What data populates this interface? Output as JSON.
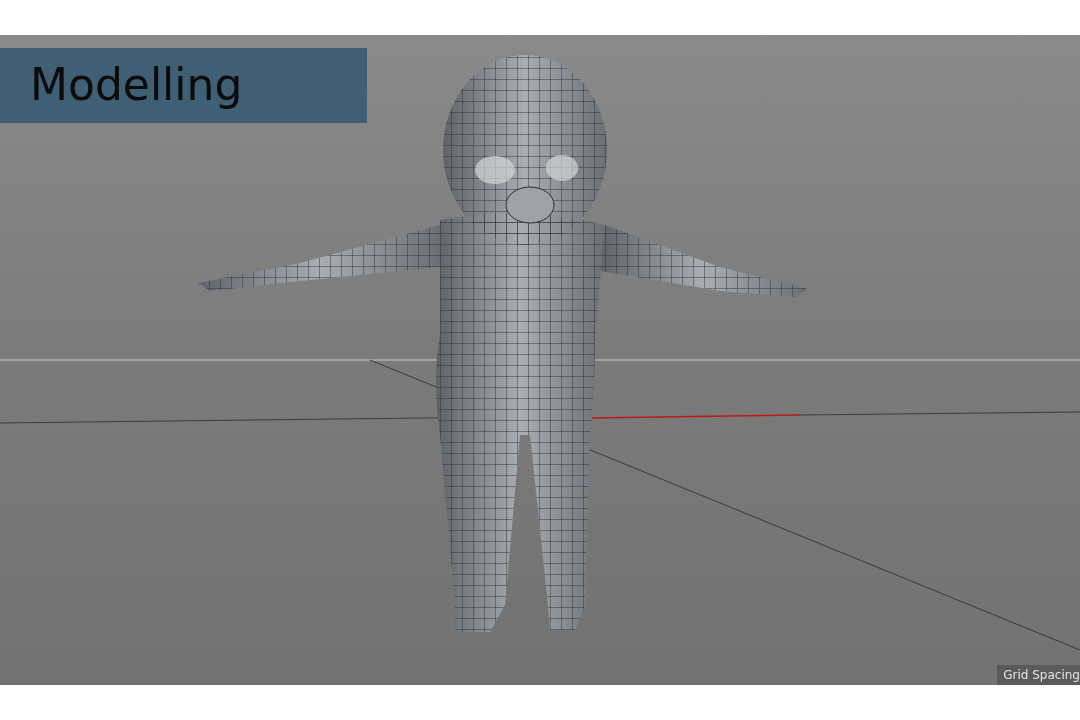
{
  "slide": {
    "title": "Modelling"
  },
  "viewport": {
    "grid_label": "Grid Spacing"
  }
}
